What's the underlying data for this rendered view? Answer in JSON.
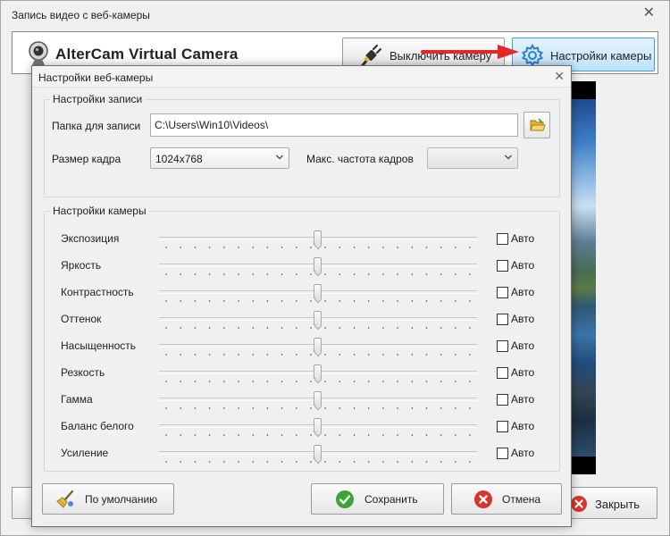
{
  "window": {
    "title": "Запись видео с веб-камеры",
    "close_glyph": "✕"
  },
  "header": {
    "brand": "AlterCam Virtual Camera",
    "disable_camera_label": "Выключить камеру",
    "camera_settings_label": "Настройки камеры"
  },
  "footer": {
    "close_label": "Закрыть"
  },
  "dialog": {
    "title": "Настройки веб-камеры",
    "close_glyph": "✕",
    "recording": {
      "group_label": "Настройки записи",
      "folder_label": "Папка для записи",
      "folder_value": "C:\\Users\\Win10\\Videos\\",
      "frame_size_label": "Размер кадра",
      "frame_size_value": "1024x768",
      "max_fps_label": "Макс. частота кадров",
      "max_fps_value": ""
    },
    "camera": {
      "group_label": "Настройки камеры",
      "auto_label": "Авто",
      "items": [
        {
          "label": "Экспозиция",
          "auto": false,
          "level": 0.5
        },
        {
          "label": "Яркость",
          "auto": false,
          "level": 0.5
        },
        {
          "label": "Контрастность",
          "auto": false,
          "level": 0.5
        },
        {
          "label": "Оттенок",
          "auto": false,
          "level": 0.5
        },
        {
          "label": "Насыщенность",
          "auto": false,
          "level": 0.5
        },
        {
          "label": "Резкость",
          "auto": false,
          "level": 0.5
        },
        {
          "label": "Гамма",
          "auto": false,
          "level": 0.5
        },
        {
          "label": "Баланс белого",
          "auto": false,
          "level": 0.5
        },
        {
          "label": "Усиление",
          "auto": false,
          "level": 0.5
        }
      ]
    },
    "buttons": {
      "default_label": "По умолчанию",
      "save_label": "Сохранить",
      "cancel_label": "Отмена"
    }
  },
  "icons": [
    "webcam-icon",
    "plug-icon",
    "gear-icon",
    "folder-open-icon",
    "broom-icon",
    "check-icon",
    "cancel-icon",
    "close-icon",
    "chevron-down-icon"
  ],
  "colors": {
    "accent_button_bg": "#bfe2fb",
    "accent_button_border": "#3c9ee8",
    "arrow": "#e8262a",
    "save_icon": "#3aa534",
    "cancel_icon": "#d9342b"
  }
}
